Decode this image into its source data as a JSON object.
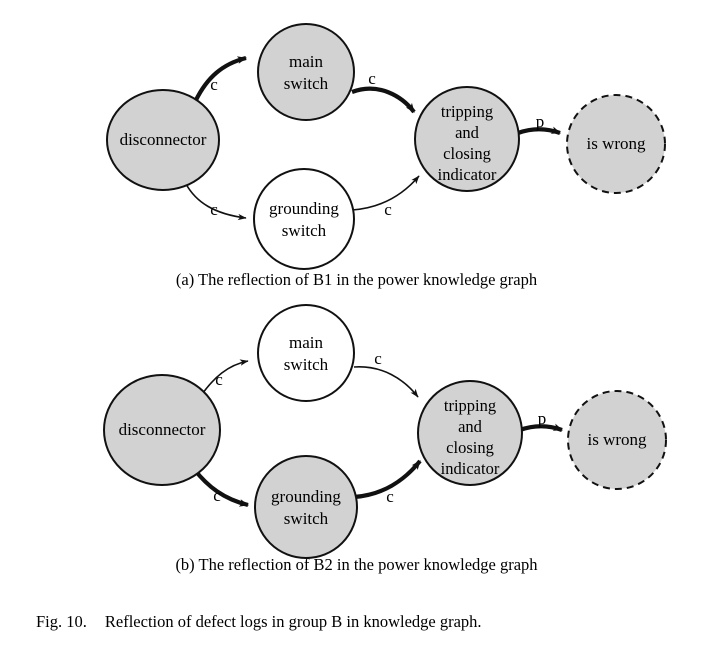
{
  "figure": {
    "number_label": "Fig. 10.",
    "caption": "Reflection of defect logs in group B in knowledge graph."
  },
  "colors": {
    "node_fill_gray": "#d2d2d2",
    "node_fill_white": "#ffffff",
    "stroke": "#111111",
    "background": "#ffffff"
  },
  "panels": [
    {
      "id": "a",
      "caption": "(a) The reflection of B1 in the power knowledge graph",
      "nodes": {
        "disconnector": {
          "label": "disconnector",
          "fill": "gray",
          "border": "solid"
        },
        "main_switch": {
          "label_line1": "main",
          "label_line2": "switch",
          "fill": "gray",
          "border": "solid"
        },
        "grounding_switch": {
          "label_line1": "grounding",
          "label_line2": "switch",
          "fill": "white",
          "border": "solid"
        },
        "indicator": {
          "label_line1": "tripping",
          "label_line2": "and",
          "label_line3": "closing",
          "label_line4": "indicator",
          "fill": "gray",
          "border": "solid"
        },
        "is_wrong": {
          "label": "is wrong",
          "fill": "gray",
          "border": "dashed"
        }
      },
      "edges": [
        {
          "id": "disconnector-main-switch",
          "label": "c",
          "weight": "bold"
        },
        {
          "id": "main-switch-indicator",
          "label": "c",
          "weight": "bold"
        },
        {
          "id": "disconnector-grounding-switch",
          "label": "c",
          "weight": "thin"
        },
        {
          "id": "grounding-switch-indicator",
          "label": "c",
          "weight": "thin"
        },
        {
          "id": "indicator-is-wrong",
          "label": "p",
          "weight": "bold"
        }
      ]
    },
    {
      "id": "b",
      "caption": "(b) The reflection of B2 in the power knowledge graph",
      "nodes": {
        "disconnector": {
          "label": "disconnector",
          "fill": "gray",
          "border": "solid"
        },
        "main_switch": {
          "label_line1": "main",
          "label_line2": "switch",
          "fill": "white",
          "border": "solid"
        },
        "grounding_switch": {
          "label_line1": "grounding",
          "label_line2": "switch",
          "fill": "gray",
          "border": "solid"
        },
        "indicator": {
          "label_line1": "tripping",
          "label_line2": "and",
          "label_line3": "closing",
          "label_line4": "indicator",
          "fill": "gray",
          "border": "solid"
        },
        "is_wrong": {
          "label": "is wrong",
          "fill": "gray",
          "border": "dashed"
        }
      },
      "edges": [
        {
          "id": "disconnector-main-switch",
          "label": "c",
          "weight": "thin"
        },
        {
          "id": "main-switch-indicator",
          "label": "c",
          "weight": "thin"
        },
        {
          "id": "disconnector-grounding-switch",
          "label": "c",
          "weight": "bold"
        },
        {
          "id": "grounding-switch-indicator",
          "label": "c",
          "weight": "bold"
        },
        {
          "id": "indicator-is-wrong",
          "label": "p",
          "weight": "bold"
        }
      ]
    }
  ]
}
